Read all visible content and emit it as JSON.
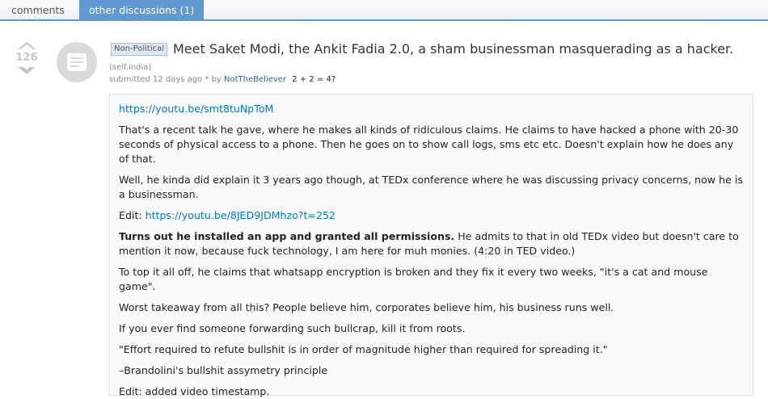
{
  "tabs": {
    "comments": "comments",
    "other": "other discussions (1)"
  },
  "vote": {
    "score": "126"
  },
  "post": {
    "flair": "Non-Political",
    "title": "Meet Saket Modi, the Ankit Fadia 2.0, a sham businessman masquerading as a hacker.",
    "domain": "(self.india)",
    "submitted": "submitted 12 days ago * by",
    "author": "NotTheBeliever",
    "author_flair": "2 + 2 = 4?"
  },
  "body": {
    "link1": "https://youtu.be/smt8tuNpToM",
    "p1": "That's a recent talk he gave, where he makes all kinds of ridiculous claims. He claims to have hacked a phone with 20-30 seconds of physical access to a phone. Then he goes on to show call logs, sms etc etc. Doesn't explain how he does any of that.",
    "p2": "Well, he kinda did explain it 3 years ago though, at TEDx conference where he was discussing privacy concerns, now he is a businessman.",
    "edit_prefix": "Edit: ",
    "link2": "https://youtu.be/8JED9JDMhzo?t=252",
    "p4_bold": "Turns out he installed an app and granted all permissions.",
    "p4_rest": " He admits to that in old TEDx video but doesn't care to mention it now, because fuck technology, I am here for muh monies. (4:20 in TED video.)",
    "p5": "To top it all off, he claims that whatsapp encryption is broken and they fix it every two weeks, \"it's a cat and mouse game\".",
    "p6": "Worst takeaway from all this? People believe him, corporates believe him, his business runs well.",
    "p7": "If you ever find someone forwarding such bullcrap, kill it from roots.",
    "p8": "\"Effort required to refute bullshit is in order of magnitude higher than required for spreading it.\"",
    "p9": "–Brandolini's bullshit assymetry principle",
    "p10": "Edit: added video timestamp."
  }
}
